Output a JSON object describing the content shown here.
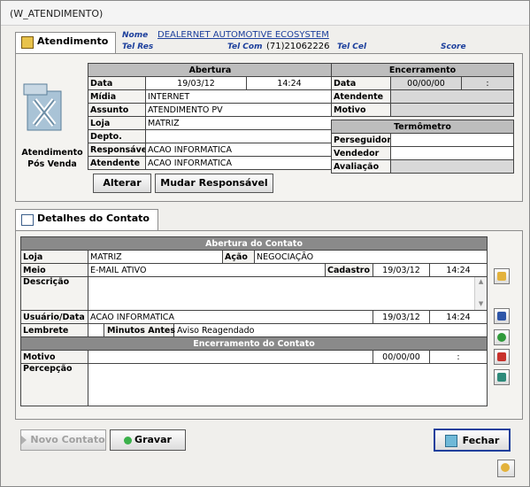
{
  "window": {
    "title": "(W_ATENDIMENTO)"
  },
  "header": {
    "nome_label": "Nome",
    "nome_value": "DEALERNET AUTOMOTIVE ECOSYSTEM",
    "tel_res_label": "Tel Res",
    "tel_com_label": "Tel Com",
    "tel_com_value": "(71)21062226",
    "tel_cel_label": "Tel Cel",
    "score_label": "Score"
  },
  "tab_atendimento": {
    "label": "Atendimento",
    "icon_caption_line1": "Atendimento",
    "icon_caption_line2": "Pós Venda",
    "abertura": {
      "header": "Abertura",
      "data_label": "Data",
      "data_value": "19/03/12",
      "hora_value": "14:24",
      "midia_label": "Mídia",
      "midia_value": "INTERNET",
      "assunto_label": "Assunto",
      "assunto_value": "ATENDIMENTO PV",
      "loja_label": "Loja",
      "loja_value": "MATRIZ",
      "depto_label": "Depto.",
      "depto_value": "",
      "responsavel_label": "Responsável",
      "responsavel_value": "ACAO INFORMATICA",
      "atendente_label": "Atendente",
      "atendente_value": "ACAO INFORMATICA"
    },
    "encerramento": {
      "header": "Encerramento",
      "data_label": "Data",
      "data_value": "00/00/00",
      "hora_value": ":",
      "atendente_label": "Atendente",
      "motivo_label": "Motivo",
      "termometro_header": "Termômetro",
      "perseguidor_label": "Perseguidor",
      "vendedor_label": "Vendedor",
      "avaliacao_label": "Avaliação"
    },
    "alterar_button": "Alterar",
    "mudar_responsavel_button": "Mudar Responsável"
  },
  "tab_detalhes": {
    "label": "Detalhes do Contato",
    "abertura_header": "Abertura do Contato",
    "loja_label": "Loja",
    "loja_value": "MATRIZ",
    "acao_label": "Ação",
    "acao_value": "NEGOCIAÇÃO",
    "meio_label": "Meio",
    "meio_value": "E-MAIL ATIVO",
    "cadastro_label": "Cadastro",
    "cadastro_data": "19/03/12",
    "cadastro_hora": "14:24",
    "descricao_label": "Descrição",
    "usuario_label": "Usuário/Data",
    "usuario_value": "ACAO INFORMATICA",
    "usuario_data": "19/03/12",
    "usuario_hora": "14:24",
    "lembrete_label": "Lembrete",
    "minutos_label": "Minutos Antes",
    "minutos_value": "Aviso Reagendado",
    "encerramento_header": "Encerramento do Contato",
    "motivo_label": "Motivo",
    "motivo_data": "00/00/00",
    "motivo_hora": ":",
    "percepcao_label": "Percepção"
  },
  "footer": {
    "novo_contato_button": "Novo Contato",
    "gravar_button": "Gravar",
    "fechar_button": "Fechar"
  },
  "colors": {
    "accent": "#1c3f9c",
    "header_gray": "#8a8a8a"
  }
}
